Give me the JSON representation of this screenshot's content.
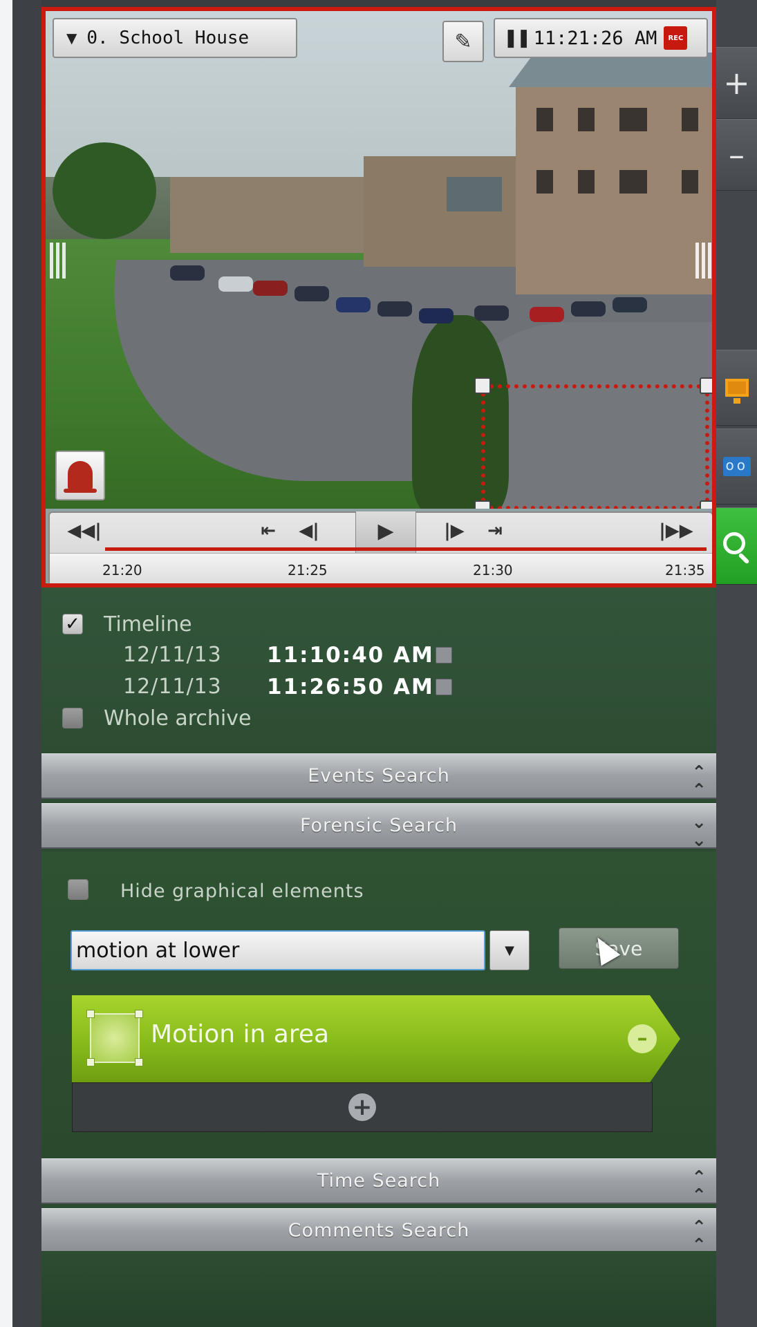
{
  "camera": {
    "name": "0. School House",
    "time": "11:21:26 AM",
    "rec_badge": "REC"
  },
  "playback": {
    "ticks": [
      "21:20",
      "21:25",
      "21:30",
      "21:35"
    ]
  },
  "search_panel": {
    "timeline": {
      "label": "Timeline",
      "checked": true,
      "start_date": "12/11/13",
      "start_time": "11:10:40 AM",
      "end_date": "12/11/13",
      "end_time": "11:26:50 AM"
    },
    "whole_archive": {
      "label": "Whole archive",
      "checked": false
    },
    "sections": {
      "events": "Events Search",
      "forensic": "Forensic Search",
      "time": "Time Search",
      "comments": "Comments Search"
    },
    "forensic": {
      "hide_graphical_label": "Hide graphical elements",
      "query_value": "motion at lower",
      "save_label": "Save",
      "condition_label": "Motion in area"
    }
  },
  "colors": {
    "accent_red": "#cc1a10",
    "panel_green": "#2b4a2f",
    "condition_green": "#84b81a",
    "search_tool_green": "#22a024"
  },
  "icons": {
    "right_toolbar": [
      "plus-icon",
      "minus-icon",
      "monitor-icon",
      "tape-icon",
      "search-icon"
    ]
  }
}
